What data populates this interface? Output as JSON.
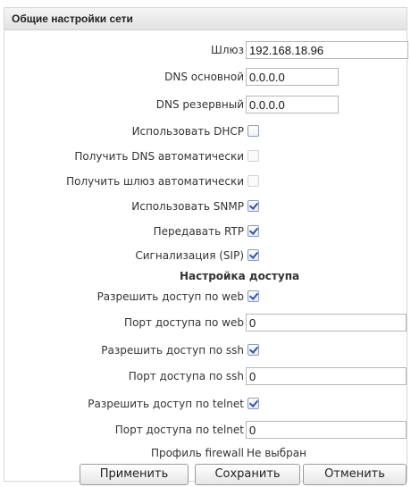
{
  "panel": {
    "title": "Общие настройки сети"
  },
  "network": {
    "gateway": {
      "label": "Шлюз",
      "value": "192.168.18.96"
    },
    "dns_primary": {
      "label": "DNS основной",
      "value": "0.0.0.0"
    },
    "dns_secondary": {
      "label": "DNS резервный",
      "value": "0.0.0.0"
    },
    "use_dhcp": {
      "label": "Использовать DHCP",
      "checked": false
    },
    "get_dns_auto": {
      "label": "Получить DNS автоматически",
      "checked": false
    },
    "get_gateway_auto": {
      "label": "Получить шлюз автоматически",
      "checked": false
    },
    "use_snmp": {
      "label": "Использовать SNMP",
      "checked": true
    },
    "send_rtp": {
      "label": "Передавать RTP",
      "checked": true
    },
    "signaling_sip": {
      "label": "Сигнализация (SIP)",
      "checked": true
    }
  },
  "access": {
    "title": "Настройка доступа",
    "allow_web": {
      "label": "Разрешить доступ по web",
      "checked": true
    },
    "web_port": {
      "label": "Порт доступа по web",
      "value": "0"
    },
    "allow_ssh": {
      "label": "Разрешить доступ по ssh",
      "checked": true
    },
    "ssh_port": {
      "label": "Порт доступа по ssh",
      "value": "0"
    },
    "allow_telnet": {
      "label": "Разрешить доступ по telnet",
      "checked": true
    },
    "telnet_port": {
      "label": "Порт доступа по telnet",
      "value": "0"
    },
    "firewall_profile": {
      "label": "Профиль firewall",
      "value": "Не выбран"
    }
  },
  "buttons": {
    "apply": "Применить",
    "save": "Сохранить",
    "cancel": "Отменить"
  }
}
